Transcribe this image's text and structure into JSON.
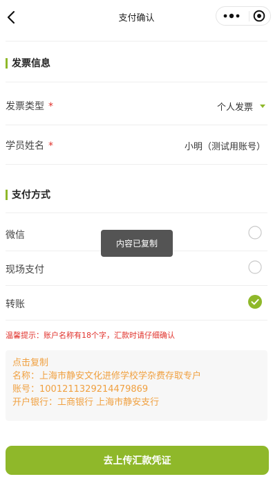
{
  "nav": {
    "title": "支付确认"
  },
  "invoice": {
    "section_title": "发票信息",
    "type_label": "发票类型",
    "type_value": "个人发票",
    "name_label": "学员姓名",
    "name_value": "小明（测试用账号）",
    "required_mark": "*"
  },
  "payment": {
    "section_title": "支付方式",
    "options": [
      {
        "label": "微信",
        "selected": false
      },
      {
        "label": "现场支付",
        "selected": false
      },
      {
        "label": "转账",
        "selected": true
      }
    ]
  },
  "toast": {
    "text": "内容已复制"
  },
  "tip": "温馨提示：账户名称有18个字，汇款时请仔细确认",
  "copy_box": {
    "action": "点击复制",
    "account_name": "名称：上海市静安文化进修学校学杂费存取专户",
    "account_number": "账号：1001211329214479869",
    "bank": "开户银行：工商银行 上海市静安支行"
  },
  "upload_button": "去上传汇款凭证",
  "colors": {
    "accent": "#8fb82a",
    "required": "#e0312b",
    "copy_text": "#f0a040",
    "toast_bg": "#3c3c3c"
  },
  "icons": [
    "back-arrow-icon",
    "more-dots-icon",
    "close-circle-icon",
    "dropdown-triangle-icon",
    "radio-unchecked-icon",
    "radio-checked-icon"
  ]
}
